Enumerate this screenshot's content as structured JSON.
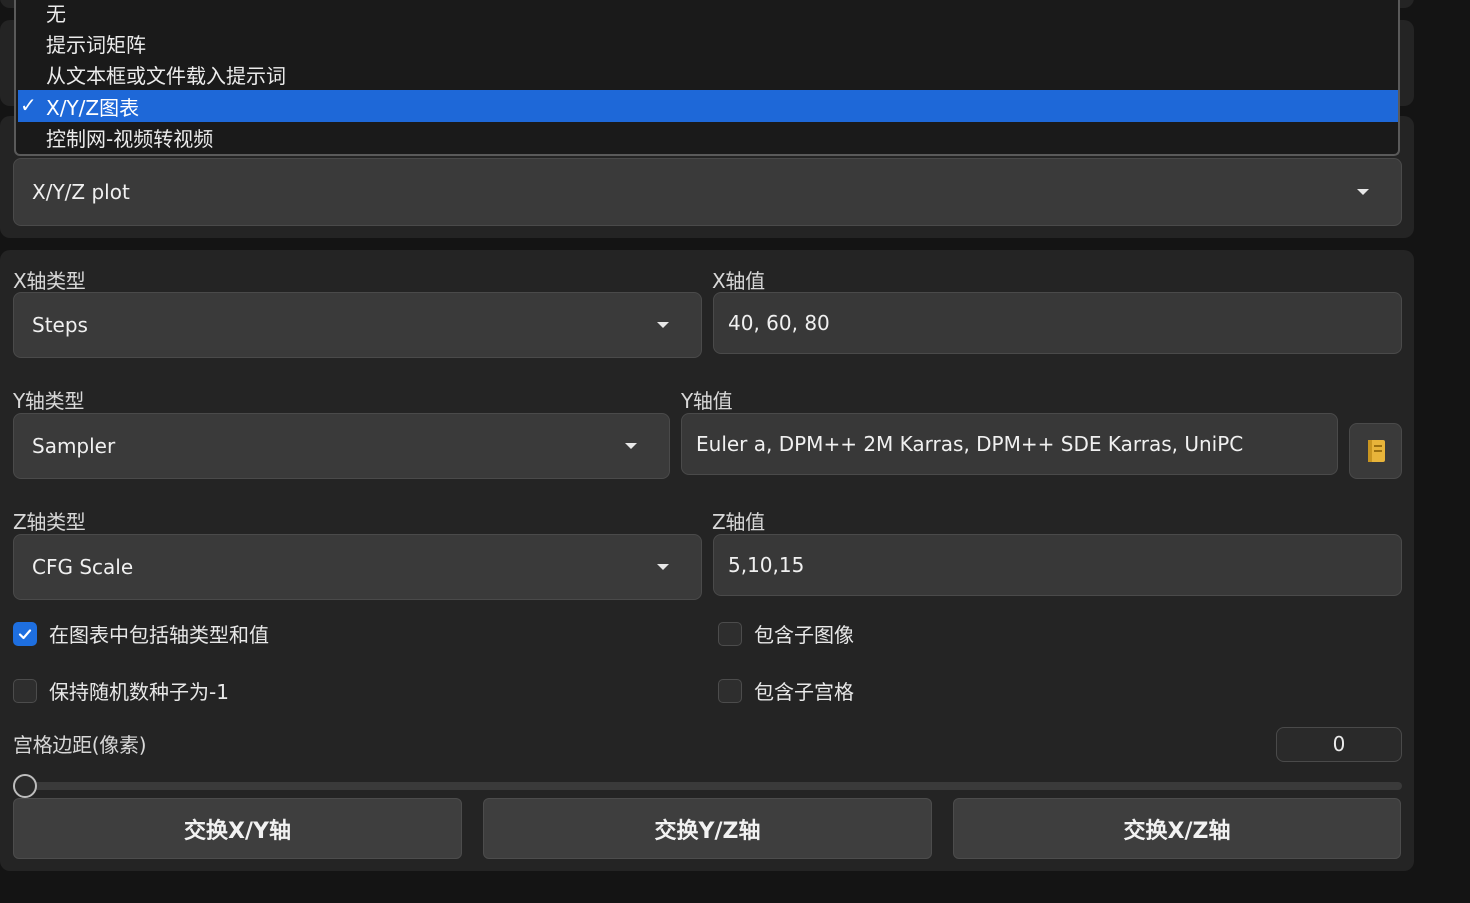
{
  "script_dropdown": {
    "options": [
      {
        "label": "无",
        "selected": false
      },
      {
        "label": "提示词矩阵",
        "selected": false
      },
      {
        "label": "从文本框或文件载入提示词",
        "selected": false
      },
      {
        "label": "X/Y/Z图表",
        "selected": true
      },
      {
        "label": "控制网-视频转视频",
        "selected": false
      }
    ],
    "check_mark": "✓",
    "selected_value": "X/Y/Z plot"
  },
  "x_axis": {
    "type_label": "X轴类型",
    "type_value": "Steps",
    "values_label": "X轴值",
    "values_value": "40, 60, 80"
  },
  "y_axis": {
    "type_label": "Y轴类型",
    "type_value": "Sampler",
    "values_label": "Y轴值",
    "values_value": "Euler a, DPM++ 2M Karras, DPM++ SDE Karras, UniPC",
    "icon": "notebook-icon"
  },
  "z_axis": {
    "type_label": "Z轴类型",
    "type_value": "CFG Scale",
    "values_label": "Z轴值",
    "values_value": "5,10,15"
  },
  "checkboxes": {
    "include_legend": {
      "label": "在图表中包括轴类型和值",
      "checked": true
    },
    "include_sub_images": {
      "label": "包含子图像",
      "checked": false
    },
    "keep_seed": {
      "label": "保持随机数种子为-1",
      "checked": false
    },
    "include_sub_grids": {
      "label": "包含子宫格",
      "checked": false
    }
  },
  "grid_margin": {
    "label": "宫格边距(像素)",
    "value": "0",
    "slider_fraction": 0
  },
  "buttons": {
    "swap_xy": "交换X/Y轴",
    "swap_yz": "交换Y/Z轴",
    "swap_xz": "交换X/Z轴"
  },
  "colors": {
    "accent": "#1e68d8",
    "background": "#141414",
    "panel": "#242424"
  }
}
